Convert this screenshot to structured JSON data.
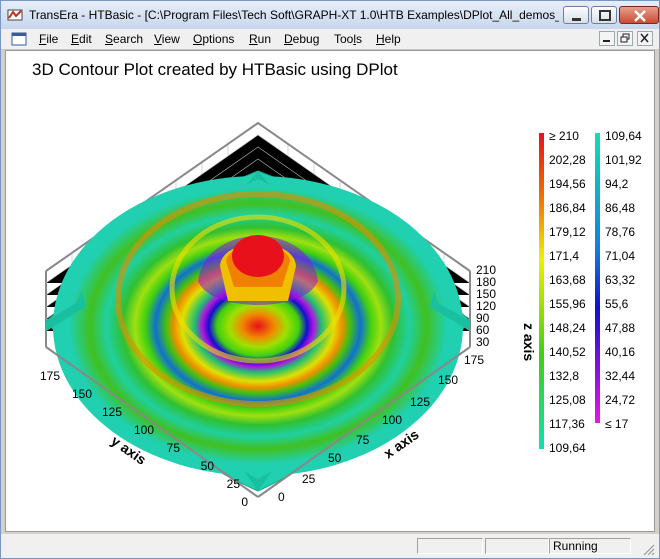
{
  "window": {
    "title": "TransEra - HTBasic - [C:\\Program Files\\Tech Soft\\GRAPH-XT 1.0\\HTB Examples\\DPlot_All_demos_..."
  },
  "menu": [
    {
      "label": "File",
      "accel": "F"
    },
    {
      "label": "Edit",
      "accel": "E"
    },
    {
      "label": "Search",
      "accel": "S"
    },
    {
      "label": "View",
      "accel": "V"
    },
    {
      "label": "Options",
      "accel": "O"
    },
    {
      "label": "Run",
      "accel": "R"
    },
    {
      "label": "Debug",
      "accel": "D"
    },
    {
      "label": "Tools",
      "accel": "l"
    },
    {
      "label": "Help",
      "accel": "H"
    }
  ],
  "plot": {
    "title": "3D Contour Plot created by HTBasic using DPlot",
    "x_label": "x axis",
    "y_label": "y axis",
    "z_label": "z axis",
    "x_ticks": [
      "0",
      "25",
      "50",
      "75",
      "100",
      "125",
      "150",
      "175"
    ],
    "y_ticks": [
      "0",
      "25",
      "50",
      "75",
      "100",
      "125",
      "150",
      "175"
    ],
    "z_ticks": [
      "30",
      "60",
      "90",
      "120",
      "150",
      "180",
      "210"
    ]
  },
  "legend": {
    "col1": [
      "≥ 210",
      "202,28",
      "194,56",
      "186,84",
      "179,12",
      "171,4",
      "163,68",
      "155,96",
      "148,24",
      "140,52",
      "132,8",
      "125,08",
      "117,36",
      "109,64"
    ],
    "col2": [
      "109,64",
      "101,92",
      "94,2",
      "86,48",
      "78,76",
      "71,04",
      "63,32",
      "55,6",
      "47,88",
      "40,16",
      "32,44",
      "24,72",
      "≤ 17"
    ],
    "colors": {
      "high": "#e8101a",
      "orange": "#f08a00",
      "yellow": "#f0f000",
      "green": "#40d010",
      "cyan": "#10e0c0",
      "blue": "#1010d0",
      "magenta": "#f010f0"
    }
  },
  "status": {
    "state": "Running"
  }
}
